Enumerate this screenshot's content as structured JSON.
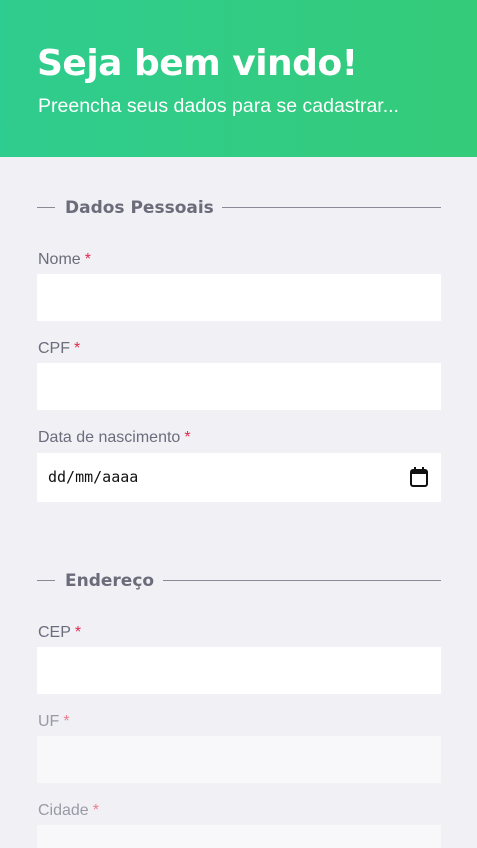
{
  "header": {
    "title": "Seja bem vindo!",
    "subtitle": "Preencha seus dados para se cadastrar..."
  },
  "sections": {
    "personal": {
      "legend": "Dados Pessoais",
      "fields": {
        "nome": {
          "label": "Nome",
          "required": "*",
          "value": ""
        },
        "cpf": {
          "label": "CPF",
          "required": "*",
          "value": ""
        },
        "birth": {
          "label": "Data de nascimento",
          "required": "*",
          "placeholder": "dd/mm/aaaa",
          "icon": "calendar-icon"
        }
      }
    },
    "address": {
      "legend": "Endereço",
      "fields": {
        "cep": {
          "label": "CEP",
          "required": "*",
          "value": ""
        },
        "uf": {
          "label": "UF",
          "required": "*",
          "value": ""
        },
        "cidade": {
          "label": "Cidade",
          "required": "*",
          "value": ""
        }
      }
    }
  },
  "colors": {
    "header_green": "#34cb79",
    "background": "#f0f0f5",
    "required_red": "#e02b4f",
    "legend_text": "#6b6b7a"
  }
}
